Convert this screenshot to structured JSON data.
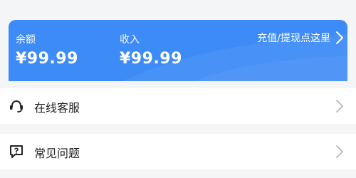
{
  "balance_card": {
    "balance_label": "余额",
    "balance_value": "¥99.99",
    "income_label": "收入",
    "income_value": "¥99.99",
    "recharge_label": "充值/提现点这里",
    "background_color": "#3d8bf7"
  },
  "menu": {
    "items": [
      {
        "label": "在线客服",
        "icon": "headset-icon"
      },
      {
        "label": "常见问题",
        "icon": "faq-chat-icon"
      }
    ]
  },
  "colors": {
    "page_background": "#f4f5f7",
    "row_background": "#ffffff",
    "chevron": "#b5b5b5"
  }
}
